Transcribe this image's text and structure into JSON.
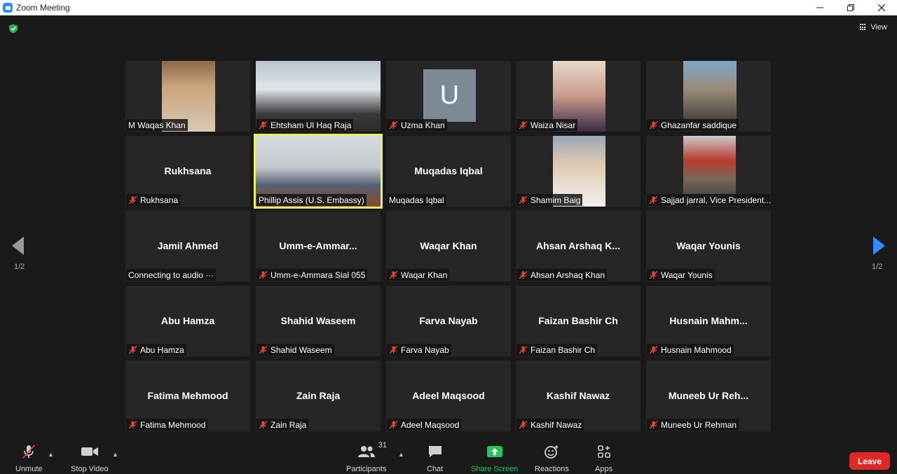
{
  "window": {
    "title": "Zoom Meeting"
  },
  "top": {
    "view_label": "View"
  },
  "pagination": {
    "left": "1/2",
    "right": "1/2"
  },
  "tiles": [
    {
      "label": "M Waqas Khan",
      "bigname": "",
      "muted": false,
      "video": true
    },
    {
      "label": "Ehtsham Ul Haq Raja",
      "bigname": "",
      "muted": true,
      "video": true
    },
    {
      "label": "Uzma Khan",
      "bigname": "",
      "muted": true,
      "video": false,
      "avatar": "U"
    },
    {
      "label": "Waiza Nisar",
      "bigname": "",
      "muted": true,
      "video": true
    },
    {
      "label": "Ghazanfar saddique",
      "bigname": "",
      "muted": true,
      "video": true
    },
    {
      "label": "Rukhsana",
      "bigname": "Rukhsana",
      "muted": true,
      "video": false
    },
    {
      "label": "Phillip Assis (U.S. Embassy)",
      "bigname": "",
      "muted": false,
      "video": true,
      "active": true
    },
    {
      "label": "Muqadas Iqbal",
      "bigname": "Muqadas Iqbal",
      "muted": false,
      "video": false
    },
    {
      "label": "Shamim Baig",
      "bigname": "",
      "muted": true,
      "video": true
    },
    {
      "label": "Sajjad jarral, Vice President...",
      "bigname": "",
      "muted": true,
      "video": true
    },
    {
      "label": "Connecting to audio ···",
      "bigname": "Jamil Ahmed",
      "muted": false,
      "video": false
    },
    {
      "label": "Umm-e-Ammara Sial 055",
      "bigname": "Umm-e-Ammar...",
      "muted": true,
      "video": false
    },
    {
      "label": "Waqar Khan",
      "bigname": "Waqar Khan",
      "muted": true,
      "video": false
    },
    {
      "label": "Ahsan Arshaq Khan",
      "bigname": "Ahsan Arshaq K...",
      "muted": true,
      "video": false
    },
    {
      "label": "Waqar Younis",
      "bigname": "Waqar Younis",
      "muted": true,
      "video": false
    },
    {
      "label": "Abu Hamza",
      "bigname": "Abu Hamza",
      "muted": true,
      "video": false
    },
    {
      "label": "Shahid Waseem",
      "bigname": "Shahid Waseem",
      "muted": true,
      "video": false
    },
    {
      "label": "Farva Nayab",
      "bigname": "Farva Nayab",
      "muted": true,
      "video": false
    },
    {
      "label": "Faizan Bashir Ch",
      "bigname": "Faizan Bashir Ch",
      "muted": true,
      "video": false
    },
    {
      "label": "Husnain Mahmood",
      "bigname": "Husnain  Mahm...",
      "muted": true,
      "video": false
    },
    {
      "label": "Fatima Mehmood",
      "bigname": "Fatima Mehmood",
      "muted": true,
      "video": false
    },
    {
      "label": "Zain Raja",
      "bigname": "Zain Raja",
      "muted": true,
      "video": false
    },
    {
      "label": "Adeel Maqsood",
      "bigname": "Adeel Maqsood",
      "muted": true,
      "video": false
    },
    {
      "label": "Kashif Nawaz",
      "bigname": "Kashif Nawaz",
      "muted": true,
      "video": false
    },
    {
      "label": "Muneeb Ur Rehman",
      "bigname": "Muneeb  Ur  Reh...",
      "muted": true,
      "video": false
    }
  ],
  "toolbar": {
    "unmute": "Unmute",
    "stop_video": "Stop Video",
    "participants": "Participants",
    "participants_count": "31",
    "chat": "Chat",
    "share_screen": "Share Screen",
    "reactions": "Reactions",
    "apps": "Apps",
    "leave": "Leave"
  },
  "colors": {
    "accent": "#2d8cff",
    "share": "#21c55d",
    "leave": "#e02828",
    "active_border": "#e8f06a",
    "muted_mic": "#e0453a"
  }
}
